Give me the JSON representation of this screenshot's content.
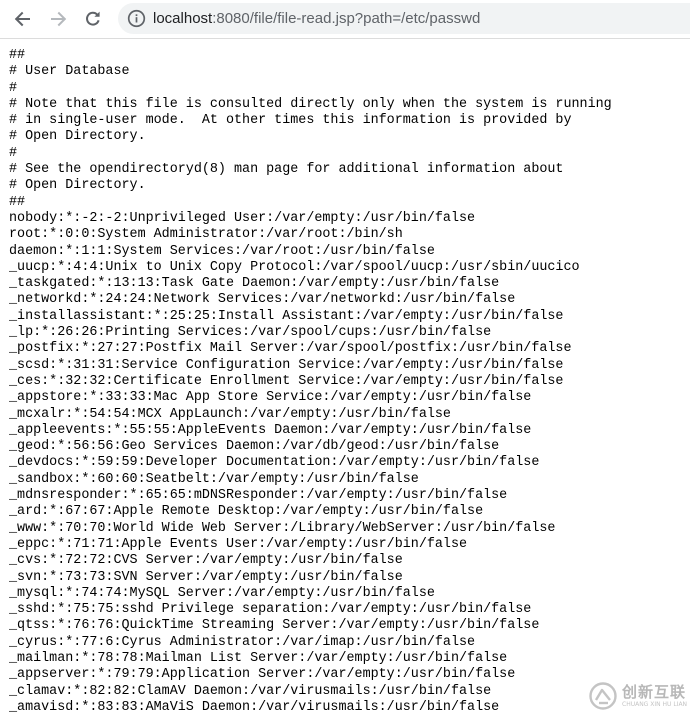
{
  "toolbar": {
    "back_icon": "arrow-left-icon",
    "forward_icon": "arrow-right-icon",
    "reload_icon": "reload-icon",
    "info_icon": "info-circle-icon",
    "url_host": "localhost",
    "url_rest": ":8080/file/file-read.jsp?path=/etc/passwd"
  },
  "file": {
    "lines": [
      "##",
      "# User Database",
      "#",
      "# Note that this file is consulted directly only when the system is running",
      "# in single-user mode.  At other times this information is provided by",
      "# Open Directory.",
      "#",
      "# See the opendirectoryd(8) man page for additional information about",
      "# Open Directory.",
      "##",
      "nobody:*:-2:-2:Unprivileged User:/var/empty:/usr/bin/false",
      "root:*:0:0:System Administrator:/var/root:/bin/sh",
      "daemon:*:1:1:System Services:/var/root:/usr/bin/false",
      "_uucp:*:4:4:Unix to Unix Copy Protocol:/var/spool/uucp:/usr/sbin/uucico",
      "_taskgated:*:13:13:Task Gate Daemon:/var/empty:/usr/bin/false",
      "_networkd:*:24:24:Network Services:/var/networkd:/usr/bin/false",
      "_installassistant:*:25:25:Install Assistant:/var/empty:/usr/bin/false",
      "_lp:*:26:26:Printing Services:/var/spool/cups:/usr/bin/false",
      "_postfix:*:27:27:Postfix Mail Server:/var/spool/postfix:/usr/bin/false",
      "_scsd:*:31:31:Service Configuration Service:/var/empty:/usr/bin/false",
      "_ces:*:32:32:Certificate Enrollment Service:/var/empty:/usr/bin/false",
      "_appstore:*:33:33:Mac App Store Service:/var/empty:/usr/bin/false",
      "_mcxalr:*:54:54:MCX AppLaunch:/var/empty:/usr/bin/false",
      "_appleevents:*:55:55:AppleEvents Daemon:/var/empty:/usr/bin/false",
      "_geod:*:56:56:Geo Services Daemon:/var/db/geod:/usr/bin/false",
      "_devdocs:*:59:59:Developer Documentation:/var/empty:/usr/bin/false",
      "_sandbox:*:60:60:Seatbelt:/var/empty:/usr/bin/false",
      "_mdnsresponder:*:65:65:mDNSResponder:/var/empty:/usr/bin/false",
      "_ard:*:67:67:Apple Remote Desktop:/var/empty:/usr/bin/false",
      "_www:*:70:70:World Wide Web Server:/Library/WebServer:/usr/bin/false",
      "_eppc:*:71:71:Apple Events User:/var/empty:/usr/bin/false",
      "_cvs:*:72:72:CVS Server:/var/empty:/usr/bin/false",
      "_svn:*:73:73:SVN Server:/var/empty:/usr/bin/false",
      "_mysql:*:74:74:MySQL Server:/var/empty:/usr/bin/false",
      "_sshd:*:75:75:sshd Privilege separation:/var/empty:/usr/bin/false",
      "_qtss:*:76:76:QuickTime Streaming Server:/var/empty:/usr/bin/false",
      "_cyrus:*:77:6:Cyrus Administrator:/var/imap:/usr/bin/false",
      "_mailman:*:78:78:Mailman List Server:/var/empty:/usr/bin/false",
      "_appserver:*:79:79:Application Server:/var/empty:/usr/bin/false",
      "_clamav:*:82:82:ClamAV Daemon:/var/virusmails:/usr/bin/false",
      "_amavisd:*:83:83:AMaViS Daemon:/var/virusmails:/usr/bin/false"
    ]
  },
  "watermark": {
    "logo_icon": "chuangxin-logo-icon",
    "cn_text": "创新互联",
    "en_text": "CHUANG XIN HU LIAN"
  },
  "colors": {
    "toolbar_bg": "#ffffff",
    "omnibox_bg": "#f1f3f4",
    "icon_gray": "#5f6368",
    "url_host": "#202124",
    "text": "#000000"
  }
}
